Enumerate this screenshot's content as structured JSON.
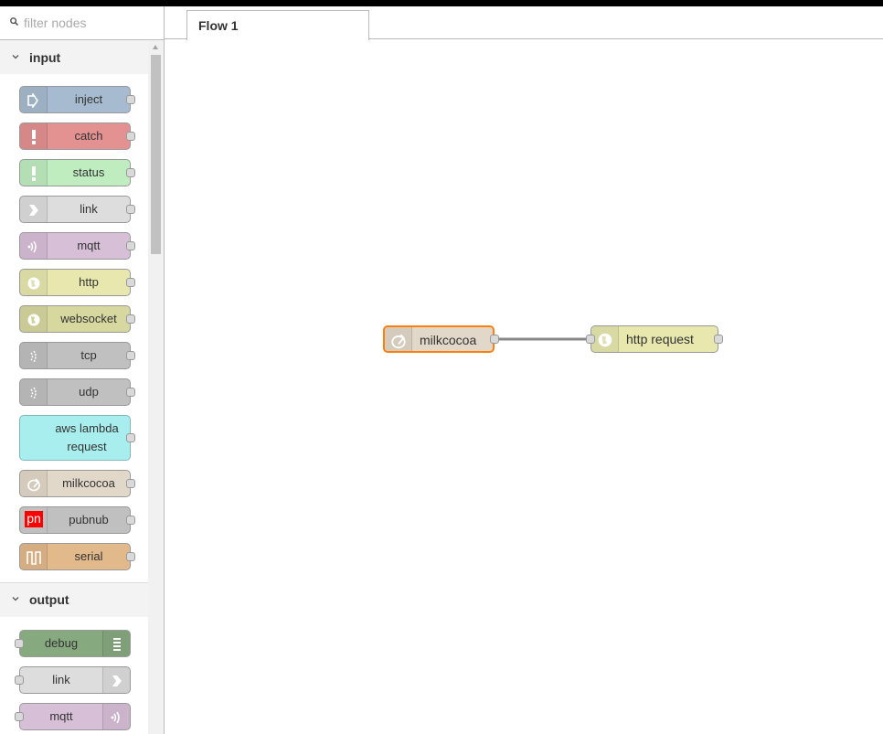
{
  "filter": {
    "placeholder": "filter nodes"
  },
  "categories": {
    "input": {
      "title": "input",
      "nodes": [
        {
          "label": "inject",
          "icon": "inject-arrow-icon",
          "color": "#a6bbcf"
        },
        {
          "label": "catch",
          "icon": "alert-icon",
          "color": "#e49191"
        },
        {
          "label": "status",
          "icon": "alert-icon",
          "color": "#c0edc0"
        },
        {
          "label": "link",
          "icon": "link-icon",
          "color": "#dddddd"
        },
        {
          "label": "mqtt",
          "icon": "bridge-icon",
          "color": "#d8bfd8"
        },
        {
          "label": "http",
          "icon": "globe-icon",
          "color": "#e7e7ae"
        },
        {
          "label": "websocket",
          "icon": "globe-icon",
          "color": "#d7d7a0"
        },
        {
          "label": "tcp",
          "icon": "bridge-dash-icon",
          "color": "#c0c0c0"
        },
        {
          "label": "udp",
          "icon": "bridge-dash-icon",
          "color": "#c0c0c0"
        },
        {
          "label": "aws lambda request",
          "icon": "lambda-icon",
          "color": "#a9eeee"
        },
        {
          "label": "milkcocoa",
          "icon": "milkcocoa-icon",
          "color": "#e2d8c9"
        },
        {
          "label": "pubnub",
          "icon": "pubnub-icon",
          "icon_text": "pn",
          "color": "#c0c0c0"
        },
        {
          "label": "serial",
          "icon": "serial-icon",
          "color": "#e2b98b"
        }
      ]
    },
    "output": {
      "title": "output",
      "nodes": [
        {
          "label": "debug",
          "icon": "debug-list-icon",
          "color": "#87a980"
        },
        {
          "label": "link",
          "icon": "link-icon",
          "color": "#dddddd"
        },
        {
          "label": "mqtt",
          "icon": "bridge-icon",
          "color": "#d8bfd8"
        }
      ]
    }
  },
  "tabs": [
    {
      "label": "Flow 1"
    }
  ],
  "flow": {
    "nodes": [
      {
        "label": "milkcocoa",
        "icon": "milkcocoa-icon",
        "color": "#e2d8c9",
        "selected_border": "#ff7f0e"
      },
      {
        "label": "http request",
        "icon": "globe-icon",
        "color": "#e7e7ae"
      }
    ],
    "wire_color": "#888888"
  }
}
